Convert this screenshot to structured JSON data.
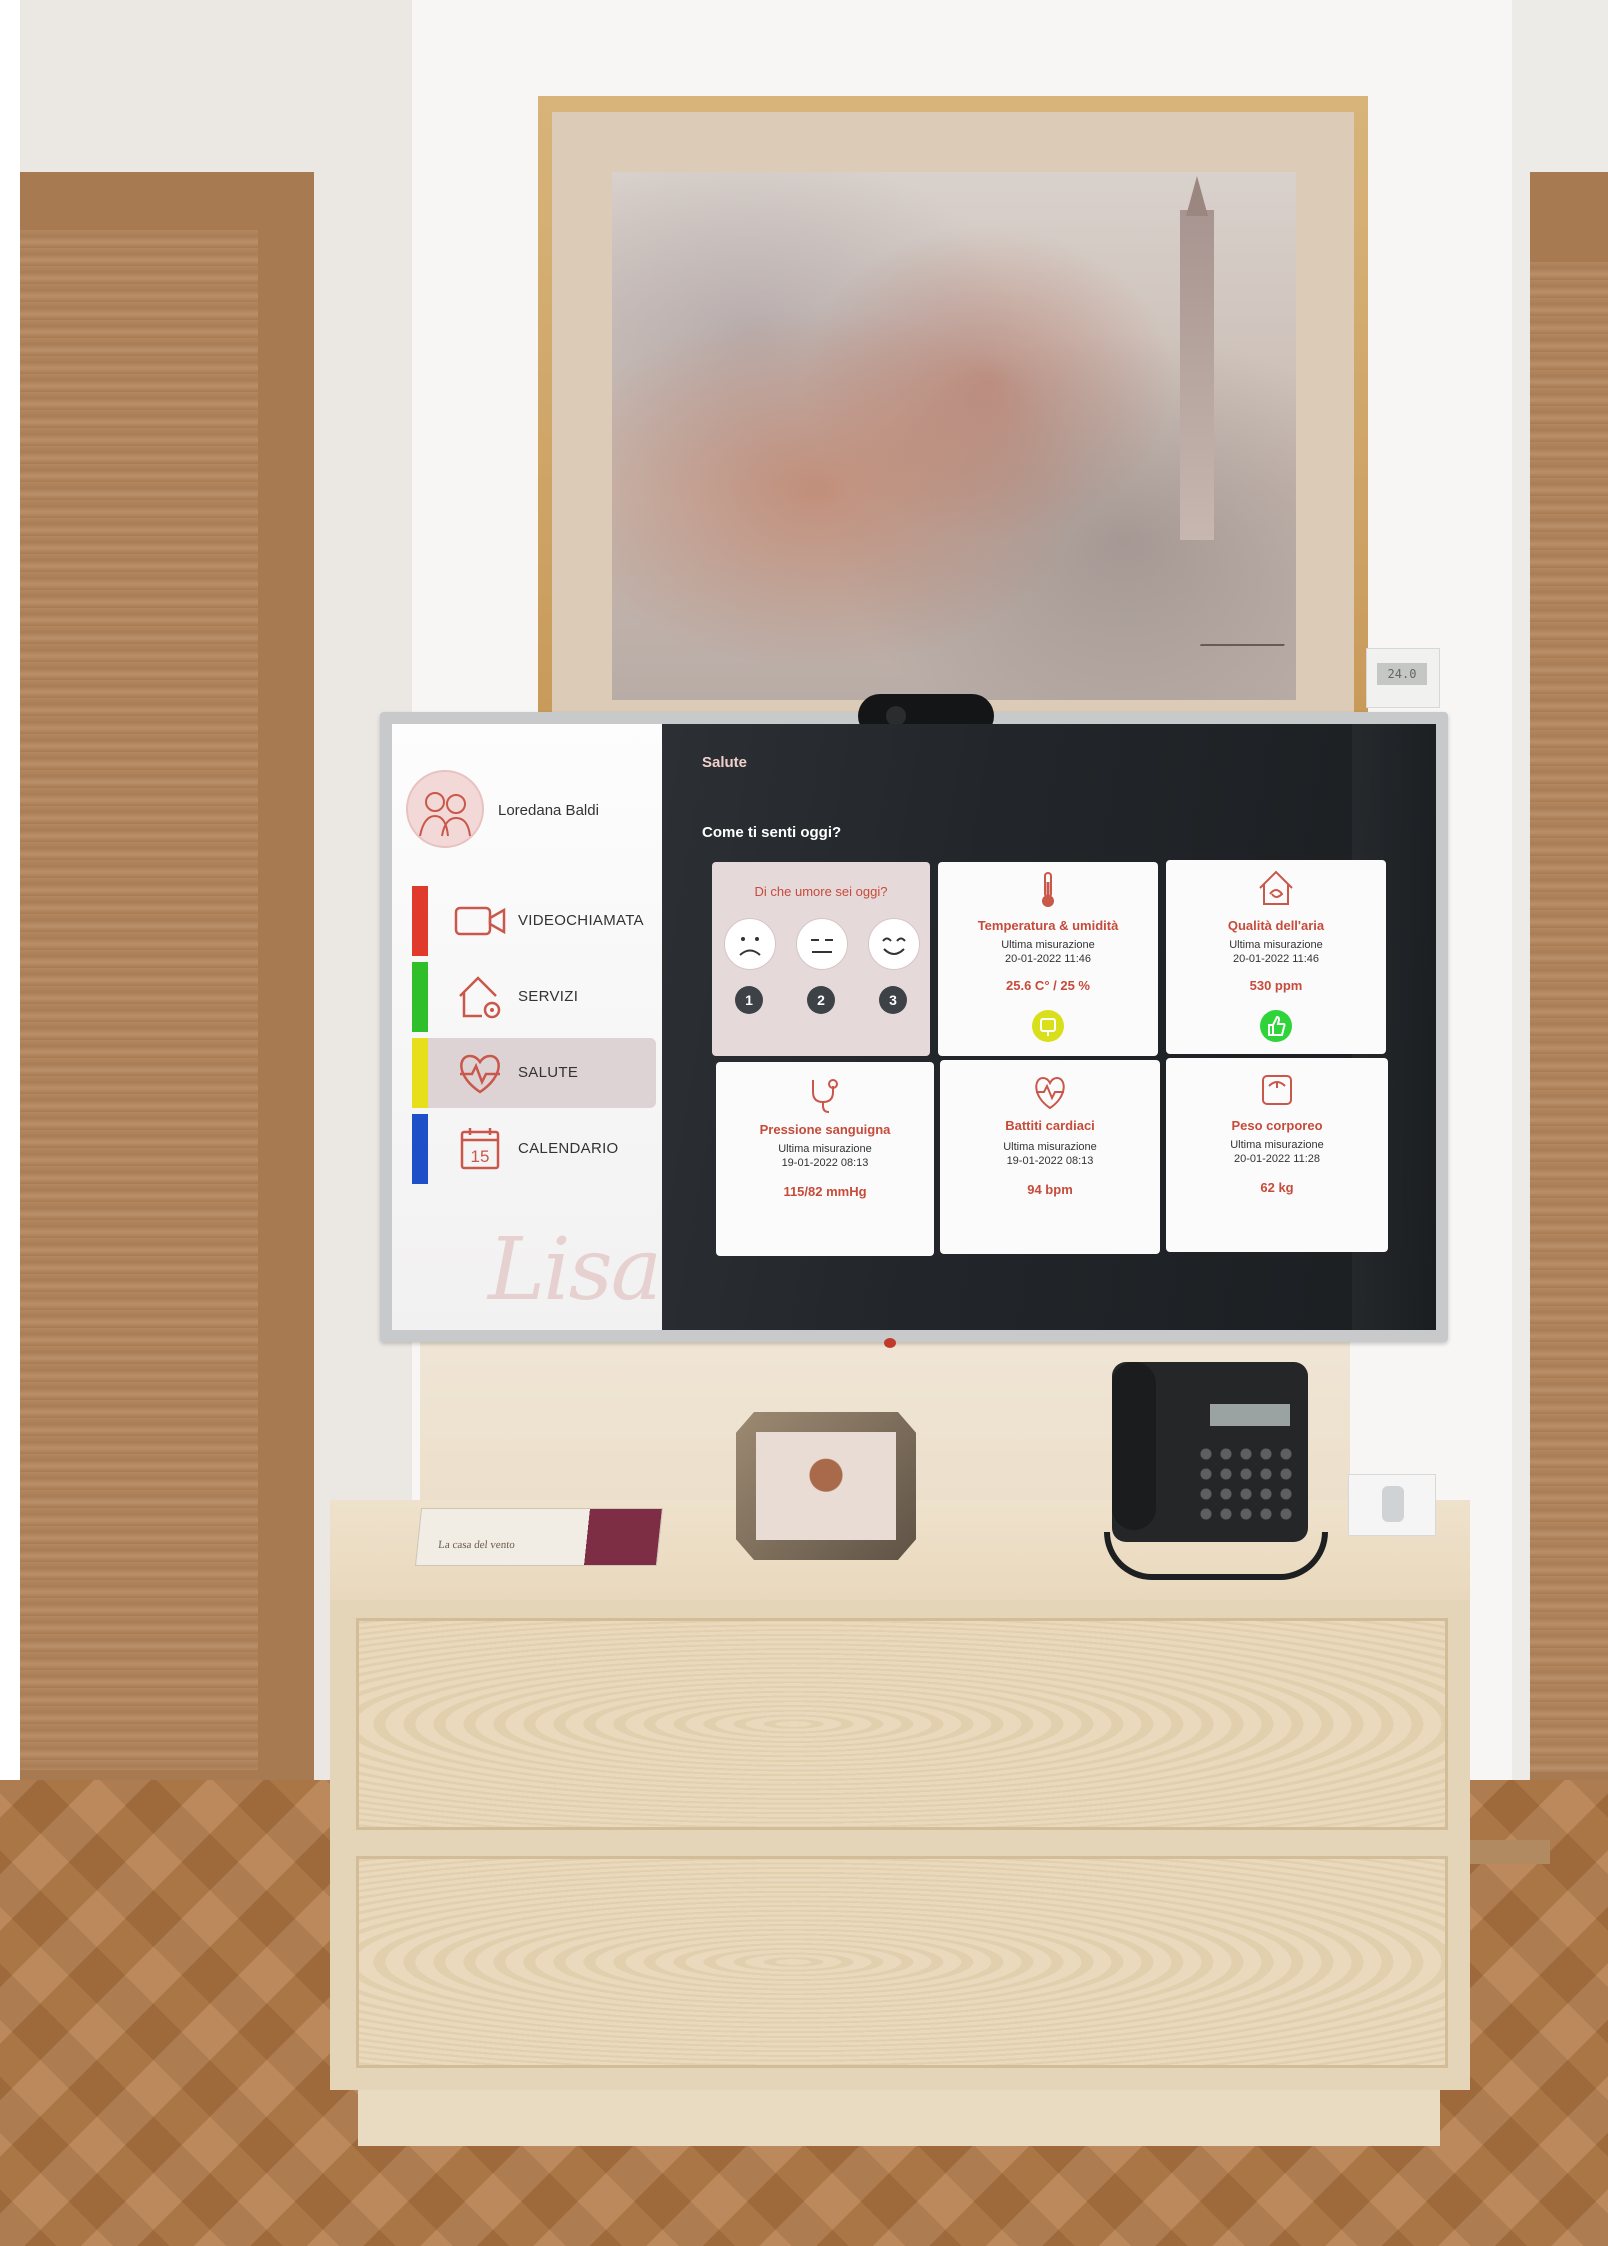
{
  "screen": {
    "user_name": "Loredana Baldi",
    "section_title": "Salute",
    "question": "Come ti senti oggi?",
    "logo_text": "Lisa",
    "nav": [
      {
        "label": "VIDEOCHIAMATA",
        "color": "#e03a2c",
        "icon": "video-camera-icon"
      },
      {
        "label": "SERVIZI",
        "color": "#2fbf2a",
        "icon": "home-gear-icon"
      },
      {
        "label": "SALUTE",
        "color": "#e8df1c",
        "icon": "heart-pulse-icon",
        "active": true
      },
      {
        "label": "CALENDARIO",
        "color": "#1f4fc8",
        "icon": "calendar-icon",
        "day": "15"
      }
    ],
    "mood_card": {
      "title": "Di che umore sei oggi?",
      "options": [
        "1",
        "2",
        "3"
      ]
    },
    "cards": [
      {
        "title": "Temperatura & umidità",
        "sub1": "Ultima misurazione",
        "sub2": "20-01-2022 11:46",
        "value": "25.6 C°   / 25 %",
        "icon": "thermometer-icon",
        "status_color": "#d9e01b"
      },
      {
        "title": "Qualità dell'aria",
        "sub1": "Ultima misurazione",
        "sub2": "20-01-2022 11:46",
        "value": "530 ppm",
        "icon": "air-quality-icon",
        "status_color": "#2fd33a"
      },
      {
        "title": "Pressione sanguigna",
        "sub1": "Ultima misurazione",
        "sub2": "19-01-2022 08:13",
        "value": "115/82 mmHg",
        "icon": "stethoscope-icon"
      },
      {
        "title": "Battiti cardiaci",
        "sub1": "Ultima misurazione",
        "sub2": "19-01-2022 08:13",
        "value": "94 bpm",
        "icon": "heartbeat-icon"
      },
      {
        "title": "Peso corporeo",
        "sub1": "Ultima misurazione",
        "sub2": "20-01-2022 11:28",
        "value": "62 kg",
        "icon": "scale-icon"
      }
    ]
  },
  "room": {
    "thermostat_reading": "24.0",
    "book_text": "La casa del vento"
  }
}
